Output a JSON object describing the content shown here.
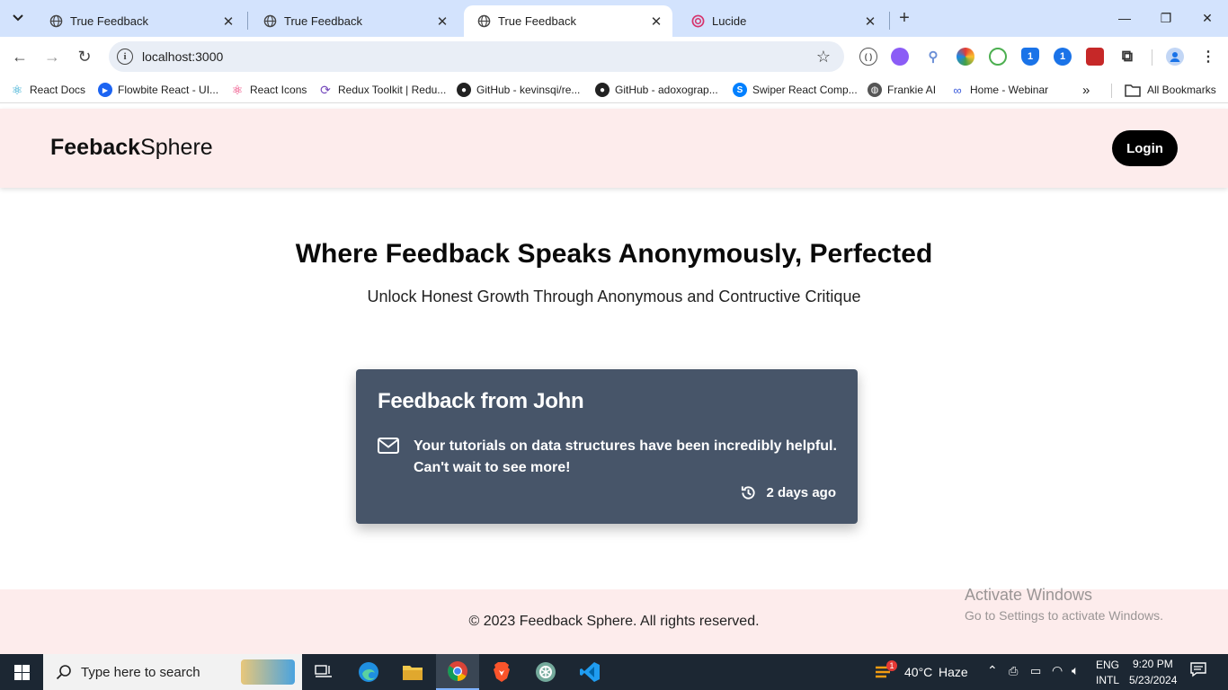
{
  "browser": {
    "tabs": [
      {
        "title": "True Feedback",
        "active": false
      },
      {
        "title": "True Feedback",
        "active": false
      },
      {
        "title": "True Feedback",
        "active": true
      },
      {
        "title": "Lucide",
        "active": false
      }
    ],
    "url": "localhost:3000",
    "bookmarks": [
      {
        "label": "React Docs",
        "icon": "react-icon"
      },
      {
        "label": "Flowbite React - UI...",
        "icon": "flowbite-icon"
      },
      {
        "label": "React Icons",
        "icon": "react-icons-icon"
      },
      {
        "label": "Redux Toolkit | Redu...",
        "icon": "redux-icon"
      },
      {
        "label": "GitHub - kevinsqi/re...",
        "icon": "github-icon"
      },
      {
        "label": "GitHub - adoxograp...",
        "icon": "github-icon"
      },
      {
        "label": "Swiper React Comp...",
        "icon": "swiper-icon"
      },
      {
        "label": "Frankie AI",
        "icon": "globe-icon"
      },
      {
        "label": "Home - Webinar",
        "icon": "webinar-icon"
      }
    ],
    "all_bookmarks": "All Bookmarks",
    "extension_badges": [
      "1",
      "1"
    ]
  },
  "site": {
    "brand_bold": "Feeback",
    "brand_light": "Sphere",
    "login_label": "Login",
    "hero_title": "Where Feedback Speaks Anonymously, Perfected",
    "hero_subtitle": "Unlock Honest Growth Through Anonymous and Contructive Critique",
    "card": {
      "title": "Feedback from John",
      "message": "Your tutorials on data structures have been incredibly helpful. Can't wait to see more!",
      "time": "2 days ago"
    },
    "footer": "© 2023 Feedback Sphere. All rights reserved.",
    "watermark_line1": "Activate Windows",
    "watermark_line2": "Go to Settings to activate Windows."
  },
  "taskbar": {
    "search_placeholder": "Type here to search",
    "weather_temp": "40°C",
    "weather_desc": "Haze",
    "weather_badge": "1",
    "lang_top": "ENG",
    "lang_bottom": "INTL",
    "time": "9:20 PM",
    "date": "5/23/2024"
  },
  "colors": {
    "tab_bar": "#d3e3fd",
    "header_bg": "#fdecec",
    "card_bg": "#475569",
    "taskbar_bg": "#1c2733"
  }
}
